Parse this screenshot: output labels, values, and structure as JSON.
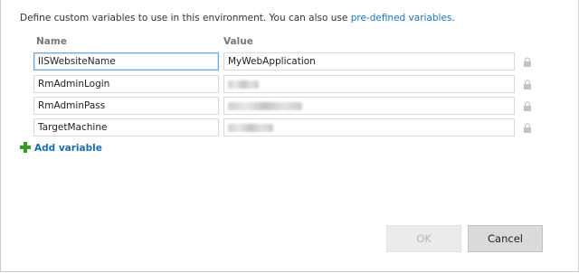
{
  "intro": {
    "text": "Define custom variables to use in this environment. You can also use ",
    "link": "pre-defined variables",
    "end": "."
  },
  "columns": {
    "name": "Name",
    "value": "Value"
  },
  "variables": [
    {
      "name": "IISWebsiteName",
      "value": "MyWebApplication"
    },
    {
      "name": "RmAdminLogin",
      "value": ""
    },
    {
      "name": "RmAdminPass",
      "value": ""
    },
    {
      "name": "TargetMachine",
      "value": ""
    }
  ],
  "add_variable": "Add variable",
  "buttons": {
    "ok": "OK",
    "cancel": "Cancel"
  },
  "icons": {
    "lock": "lock-icon",
    "add": "plus-icon"
  },
  "colors": {
    "link": "#1a73c0",
    "add_plus": "#3a9d23"
  }
}
